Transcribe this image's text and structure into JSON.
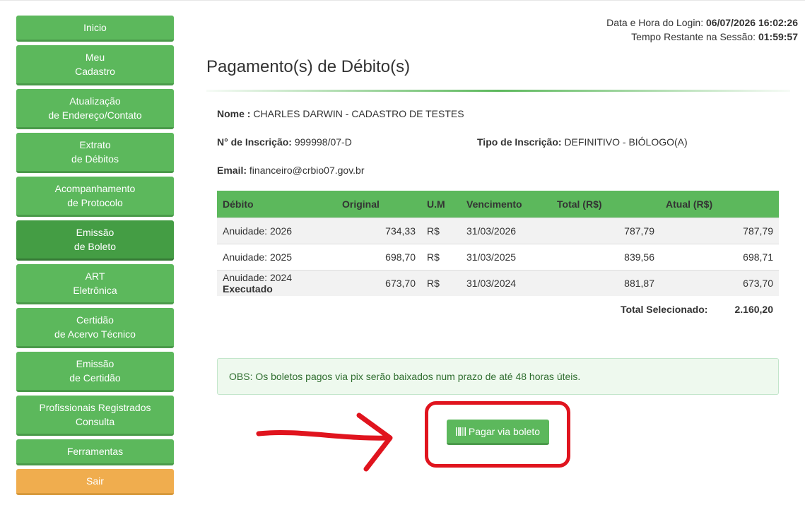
{
  "sidebar": {
    "items": [
      {
        "line1": "Inicio",
        "line2": ""
      },
      {
        "line1": "Meu",
        "line2": "Cadastro"
      },
      {
        "line1": "Atualização",
        "line2": "de Endereço/Contato"
      },
      {
        "line1": "Extrato",
        "line2": "de Débitos"
      },
      {
        "line1": "Acompanhamento",
        "line2": "de Protocolo"
      },
      {
        "line1": "Emissão",
        "line2": "de Boleto"
      },
      {
        "line1": "ART",
        "line2": "Eletrônica"
      },
      {
        "line1": "Certidão",
        "line2": "de Acervo Técnico"
      },
      {
        "line1": "Emissão",
        "line2": "de Certidão"
      },
      {
        "line1": "Profissionais Registrados",
        "line2": "Consulta"
      },
      {
        "line1": "Ferramentas",
        "line2": ""
      },
      {
        "line1": "Sair",
        "line2": ""
      }
    ]
  },
  "session": {
    "login_label": "Data e Hora do Login:",
    "login_value": "06/07/2026 16:02:26",
    "remaining_label": "Tempo Restante na Sessão:",
    "remaining_value": "01:59:57"
  },
  "page_title": "Pagamento(s) de Débito(s)",
  "profile": {
    "name_label": "Nome :",
    "name_value": "CHARLES DARWIN - CADASTRO DE TESTES",
    "inscription_label": "N° de Inscrição:",
    "inscription_value": "999998/07-D",
    "type_label": "Tipo de Inscrição:",
    "type_value": "DEFINITIVO - BIÓLOGO(A)",
    "email_label": "Email:",
    "email_value": "financeiro@crbio07.gov.br"
  },
  "table": {
    "headers": [
      "Débito",
      "Original",
      "U.M",
      "Vencimento",
      "Total (R$)",
      "Atual (R$)"
    ],
    "rows": [
      {
        "debito": "Anuidade: 2026",
        "status": "",
        "original": "734,33",
        "um": "R$",
        "vencimento": "31/03/2026",
        "total": "787,79",
        "atual": "787,79"
      },
      {
        "debito": "Anuidade: 2025",
        "status": "",
        "original": "698,70",
        "um": "R$",
        "vencimento": "31/03/2025",
        "total": "839,56",
        "atual": "698,71"
      },
      {
        "debito": "Anuidade: 2024",
        "status": "Executado",
        "original": "673,70",
        "um": "R$",
        "vencimento": "31/03/2024",
        "total": "881,87",
        "atual": "673,70"
      }
    ],
    "total_label": "Total Selecionado:",
    "total_value": "2.160,20"
  },
  "obs": "OBS: Os boletos pagos via pix serão baixados num prazo de até 48 horas úteis.",
  "pay_button": {
    "label": "Pagar via boleto",
    "icon": "barcode-icon"
  },
  "colors": {
    "primary": "#5cb85c",
    "active": "#449d44",
    "warning": "#f0ad4e",
    "annotation": "#e0141e"
  }
}
